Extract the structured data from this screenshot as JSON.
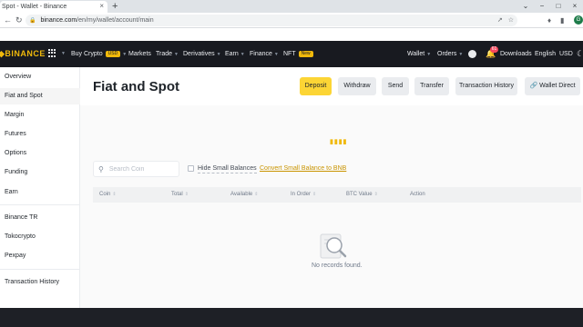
{
  "browser": {
    "tab_title": "Spot - Wallet - Binance",
    "tab_close": "×",
    "new_tab": "+",
    "url_host": "binance.com",
    "url_path": "/en/my/wallet/account/main",
    "profile_initial": "G",
    "window_controls": [
      "⌄",
      "−",
      "□",
      "×"
    ]
  },
  "header": {
    "logo": "BINANCE",
    "nav": {
      "buy_crypto": "Buy Crypto",
      "buy_crypto_badge": "USD",
      "markets": "Markets",
      "trade": "Trade",
      "derivatives": "Derivatives",
      "earn": "Earn",
      "finance": "Finance",
      "nft": "NFT",
      "nft_badge": "New"
    },
    "right": {
      "wallet": "Wallet",
      "orders": "Orders",
      "notification_count": "61",
      "downloads": "Downloads",
      "language": "English",
      "currency": "USD"
    }
  },
  "sidebar": {
    "items": [
      {
        "label": "Overview"
      },
      {
        "label": "Fiat and Spot",
        "active": true
      },
      {
        "label": "Margin"
      },
      {
        "label": "Futures"
      },
      {
        "label": "Options"
      },
      {
        "label": "Funding"
      },
      {
        "label": "Earn"
      },
      {
        "label": "Binance TR"
      },
      {
        "label": "Tokocrypto"
      },
      {
        "label": "Pexpay"
      },
      {
        "label": "Transaction History"
      }
    ]
  },
  "main": {
    "title": "Fiat and Spot",
    "buttons": {
      "deposit": "Deposit",
      "withdraw": "Withdraw",
      "send": "Send",
      "transfer": "Transfer",
      "transaction_history": "Transaction History",
      "wallet_direct": "Wallet Direct"
    },
    "search_placeholder": "Search Coin",
    "hide_small_balances": "Hide Small Balances",
    "convert_link": "Convert Small Balance to BNB",
    "columns": [
      "Coin",
      "Total",
      "Available",
      "In Order",
      "BTC Value",
      "Action"
    ],
    "empty_text": "No records found."
  },
  "colors": {
    "brand_yellow": "#F0B90B",
    "header_bg": "#181A20",
    "button_primary": "#FCD535"
  }
}
